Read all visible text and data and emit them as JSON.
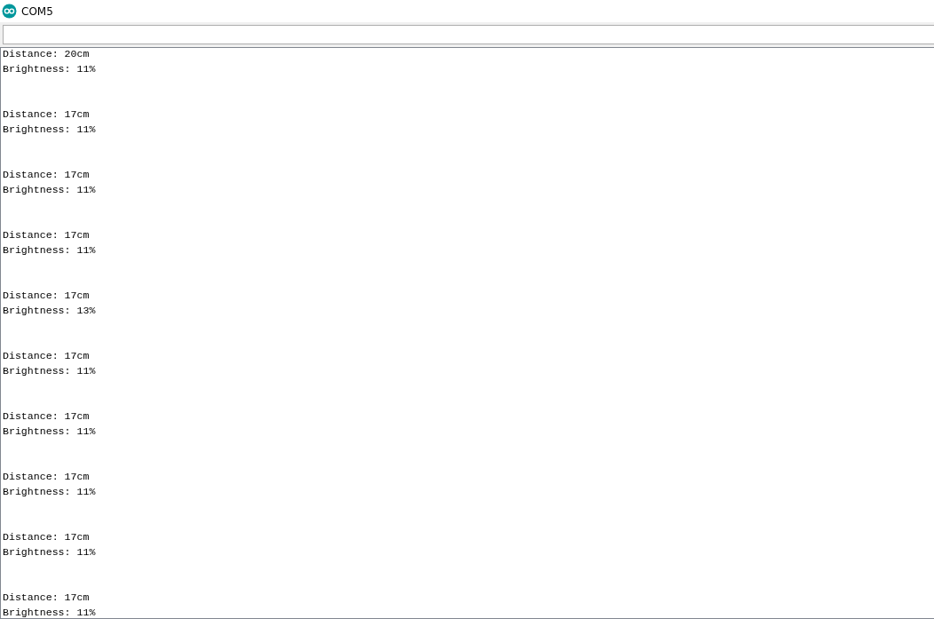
{
  "window": {
    "title": "COM5"
  },
  "readings": [
    {
      "distance": "Distance: 20cm",
      "brightness": "Brightness: 11%"
    },
    {
      "distance": "Distance: 17cm",
      "brightness": "Brightness: 11%"
    },
    {
      "distance": "Distance: 17cm",
      "brightness": "Brightness: 11%"
    },
    {
      "distance": "Distance: 17cm",
      "brightness": "Brightness: 11%"
    },
    {
      "distance": "Distance: 17cm",
      "brightness": "Brightness: 13%"
    },
    {
      "distance": "Distance: 17cm",
      "brightness": "Brightness: 11%"
    },
    {
      "distance": "Distance: 17cm",
      "brightness": "Brightness: 11%"
    },
    {
      "distance": "Distance: 17cm",
      "brightness": "Brightness: 11%"
    },
    {
      "distance": "Distance: 17cm",
      "brightness": "Brightness: 11%"
    },
    {
      "distance": "Distance: 17cm",
      "brightness": "Brightness: 11%"
    }
  ]
}
